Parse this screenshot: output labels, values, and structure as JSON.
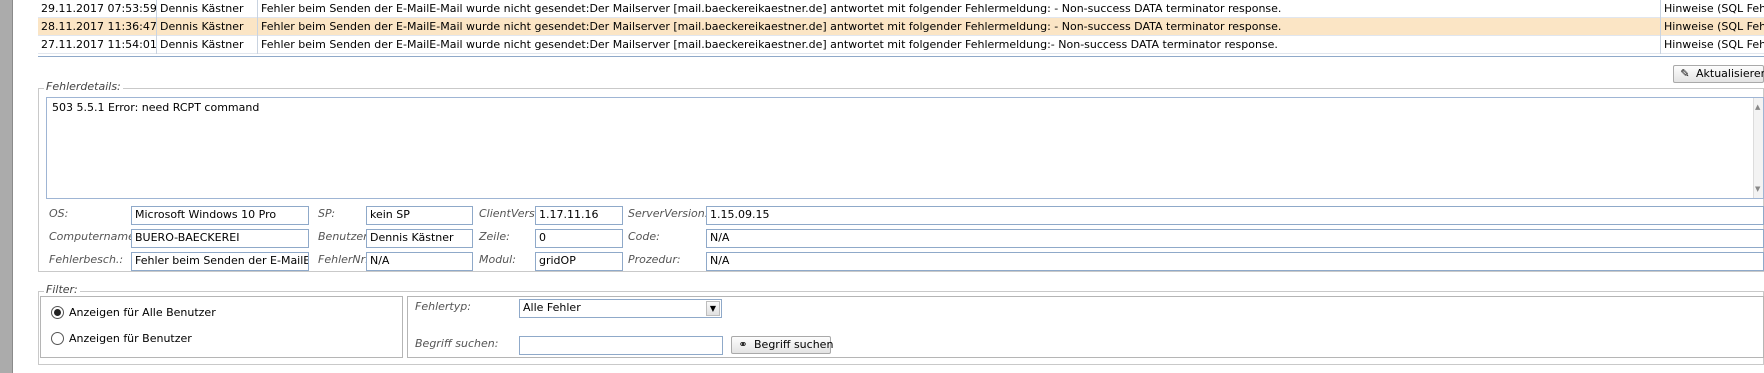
{
  "error_table": {
    "rows": [
      {
        "date": "29.11.2017 07:53:59",
        "user": "Dennis Kästner",
        "message": "Fehler beim Senden der E-MailE-Mail wurde nicht gesendet:Der Mailserver [mail.baeckereikaestner.de] antwortet mit folgender Fehlermeldung: - Non-success DATA terminator response.",
        "type": "Hinweise (SQL Fehler)",
        "selected": false
      },
      {
        "date": "28.11.2017 11:36:47",
        "user": "Dennis Kästner",
        "message": "Fehler beim Senden der E-MailE-Mail wurde nicht gesendet:Der Mailserver [mail.baeckereikaestner.de] antwortet mit folgender Fehlermeldung: - Non-success DATA terminator response.",
        "type": "Hinweise (SQL Fehler)",
        "selected": true
      },
      {
        "date": "27.11.2017 11:54:01",
        "user": "Dennis Kästner",
        "message": "Fehler beim Senden der E-MailE-Mail wurde nicht gesendet:Der Mailserver [mail.baeckereikaestner.de] antwortet mit folgender Fehlermeldung:- Non-success DATA terminator response.",
        "type": "Hinweise (SQL Fehler)",
        "selected": false
      }
    ]
  },
  "refresh_button": {
    "label": "Aktualisieren",
    "icon": "refresh-pencil-icon"
  },
  "details": {
    "legend": "Fehlerdetails:",
    "text": "503 5.5.1 Error: need RCPT command",
    "fields": {
      "os": {
        "label": "OS:",
        "value": "Microsoft Windows 10 Pro"
      },
      "sp": {
        "label": "SP:",
        "value": "kein SP"
      },
      "client_vers": {
        "label": "ClientVers:",
        "value": "1.17.11.16"
      },
      "server_version": {
        "label": "ServerVersion:",
        "value": "1.15.09.15"
      },
      "computername": {
        "label": "Computername:",
        "value": "BUERO-BAECKEREI"
      },
      "benutzer": {
        "label": "Benutzer:",
        "value": "Dennis Kästner"
      },
      "zeile": {
        "label": "Zeile:",
        "value": "0"
      },
      "code": {
        "label": "Code:",
        "value": "N/A"
      },
      "fehlerbesch": {
        "label": "Fehlerbesch.:",
        "value": "Fehler beim Senden der E-MailE-Mail"
      },
      "fehlernr": {
        "label": "FehlerNr:",
        "value": "N/A"
      },
      "modul": {
        "label": "Modul:",
        "value": "gridOP"
      },
      "prozedur": {
        "label": "Prozedur:",
        "value": "N/A"
      }
    }
  },
  "filter": {
    "legend": "Filter:",
    "radio_all": {
      "label": "Anzeigen für Alle Benutzer",
      "checked": true
    },
    "radio_user": {
      "label": "Anzeigen für Benutzer",
      "checked": false
    },
    "fehlertyp_label": "Fehlertyp:",
    "fehlertyp_value": "Alle Fehler",
    "begriff_label": "Begriff suchen:",
    "begriff_value": "",
    "search_button": {
      "label": "Begriff suchen",
      "icon": "binoculars-icon"
    }
  },
  "colors": {
    "selected_row": "#fbe5c5",
    "field_border": "#8fa9c9"
  }
}
